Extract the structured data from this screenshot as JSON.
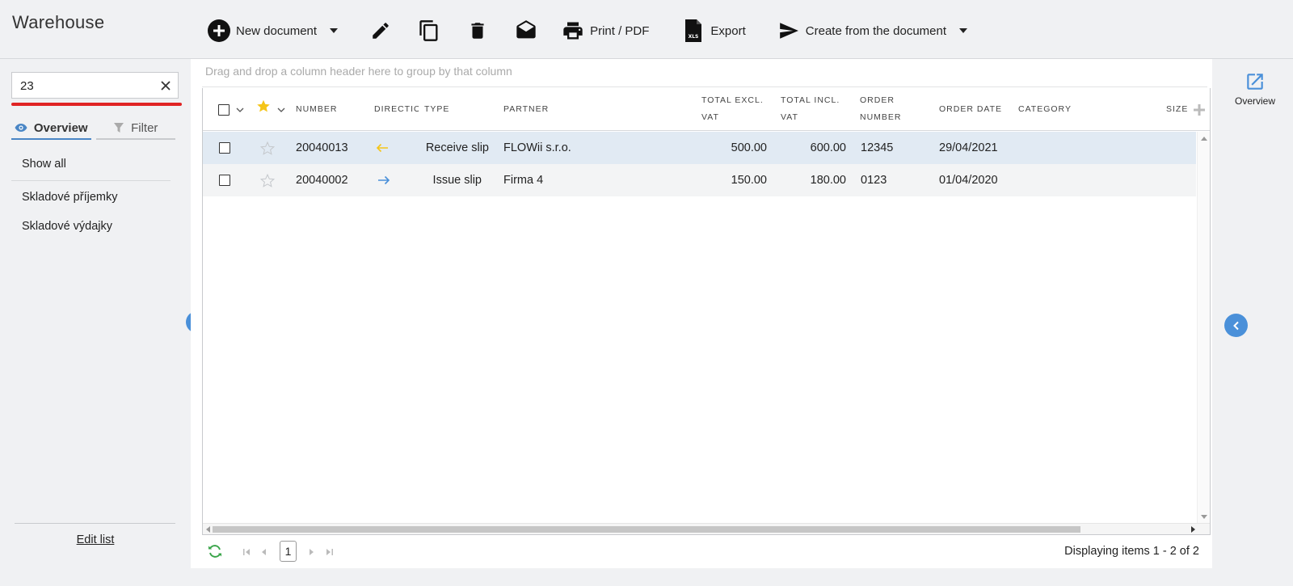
{
  "app": {
    "title": "Warehouse"
  },
  "toolbar": {
    "new_document": "New document",
    "print_pdf": "Print / PDF",
    "export": "Export",
    "create_from": "Create from the document"
  },
  "sidebar": {
    "search": {
      "value": "23"
    },
    "tabs": {
      "overview": "Overview",
      "filter": "Filter"
    },
    "items": [
      "Show all",
      "Skladové příjemky",
      "Skladové výdajky"
    ],
    "edit_list": "Edit list"
  },
  "grid": {
    "group_hint": "Drag and drop a column header here to group by that column",
    "columns": {
      "number": "NUMBER",
      "direction": "DIRECTIO",
      "type": "TYPE",
      "partner": "PARTNER",
      "total_excl_1": "TOTAL EXCL.",
      "total_excl_2": "VAT",
      "total_incl_1": "TOTAL INCL.",
      "total_incl_2": "VAT",
      "order_number_1": "ORDER",
      "order_number_2": "NUMBER",
      "order_date": "ORDER DATE",
      "category": "CATEGORY",
      "size": "SIZE"
    },
    "rows": [
      {
        "number": "20040013",
        "direction": "receive",
        "type": "Receive slip",
        "partner": "FLOWii s.r.o.",
        "total_excl": "500.00",
        "total_incl": "600.00",
        "order_number": "12345",
        "order_date": "29/04/2021",
        "category": "",
        "size": ""
      },
      {
        "number": "20040002",
        "direction": "issue",
        "type": "Issue slip",
        "partner": "Firma 4",
        "total_excl": "150.00",
        "total_incl": "180.00",
        "order_number": "0123",
        "order_date": "01/04/2020",
        "category": "",
        "size": ""
      }
    ]
  },
  "pager": {
    "current_page": "1",
    "info": "Displaying items 1 - 2 of 2"
  },
  "right_panel": {
    "overview_label": "Overview"
  },
  "colors": {
    "accent": "#4a90d9",
    "search_underline": "#e02424",
    "star": "#f5c518",
    "receive_arrow": "#f5c518",
    "issue_arrow": "#4a90d9",
    "refresh": "#3aa54a",
    "selected_row": "#e1eaf3"
  }
}
